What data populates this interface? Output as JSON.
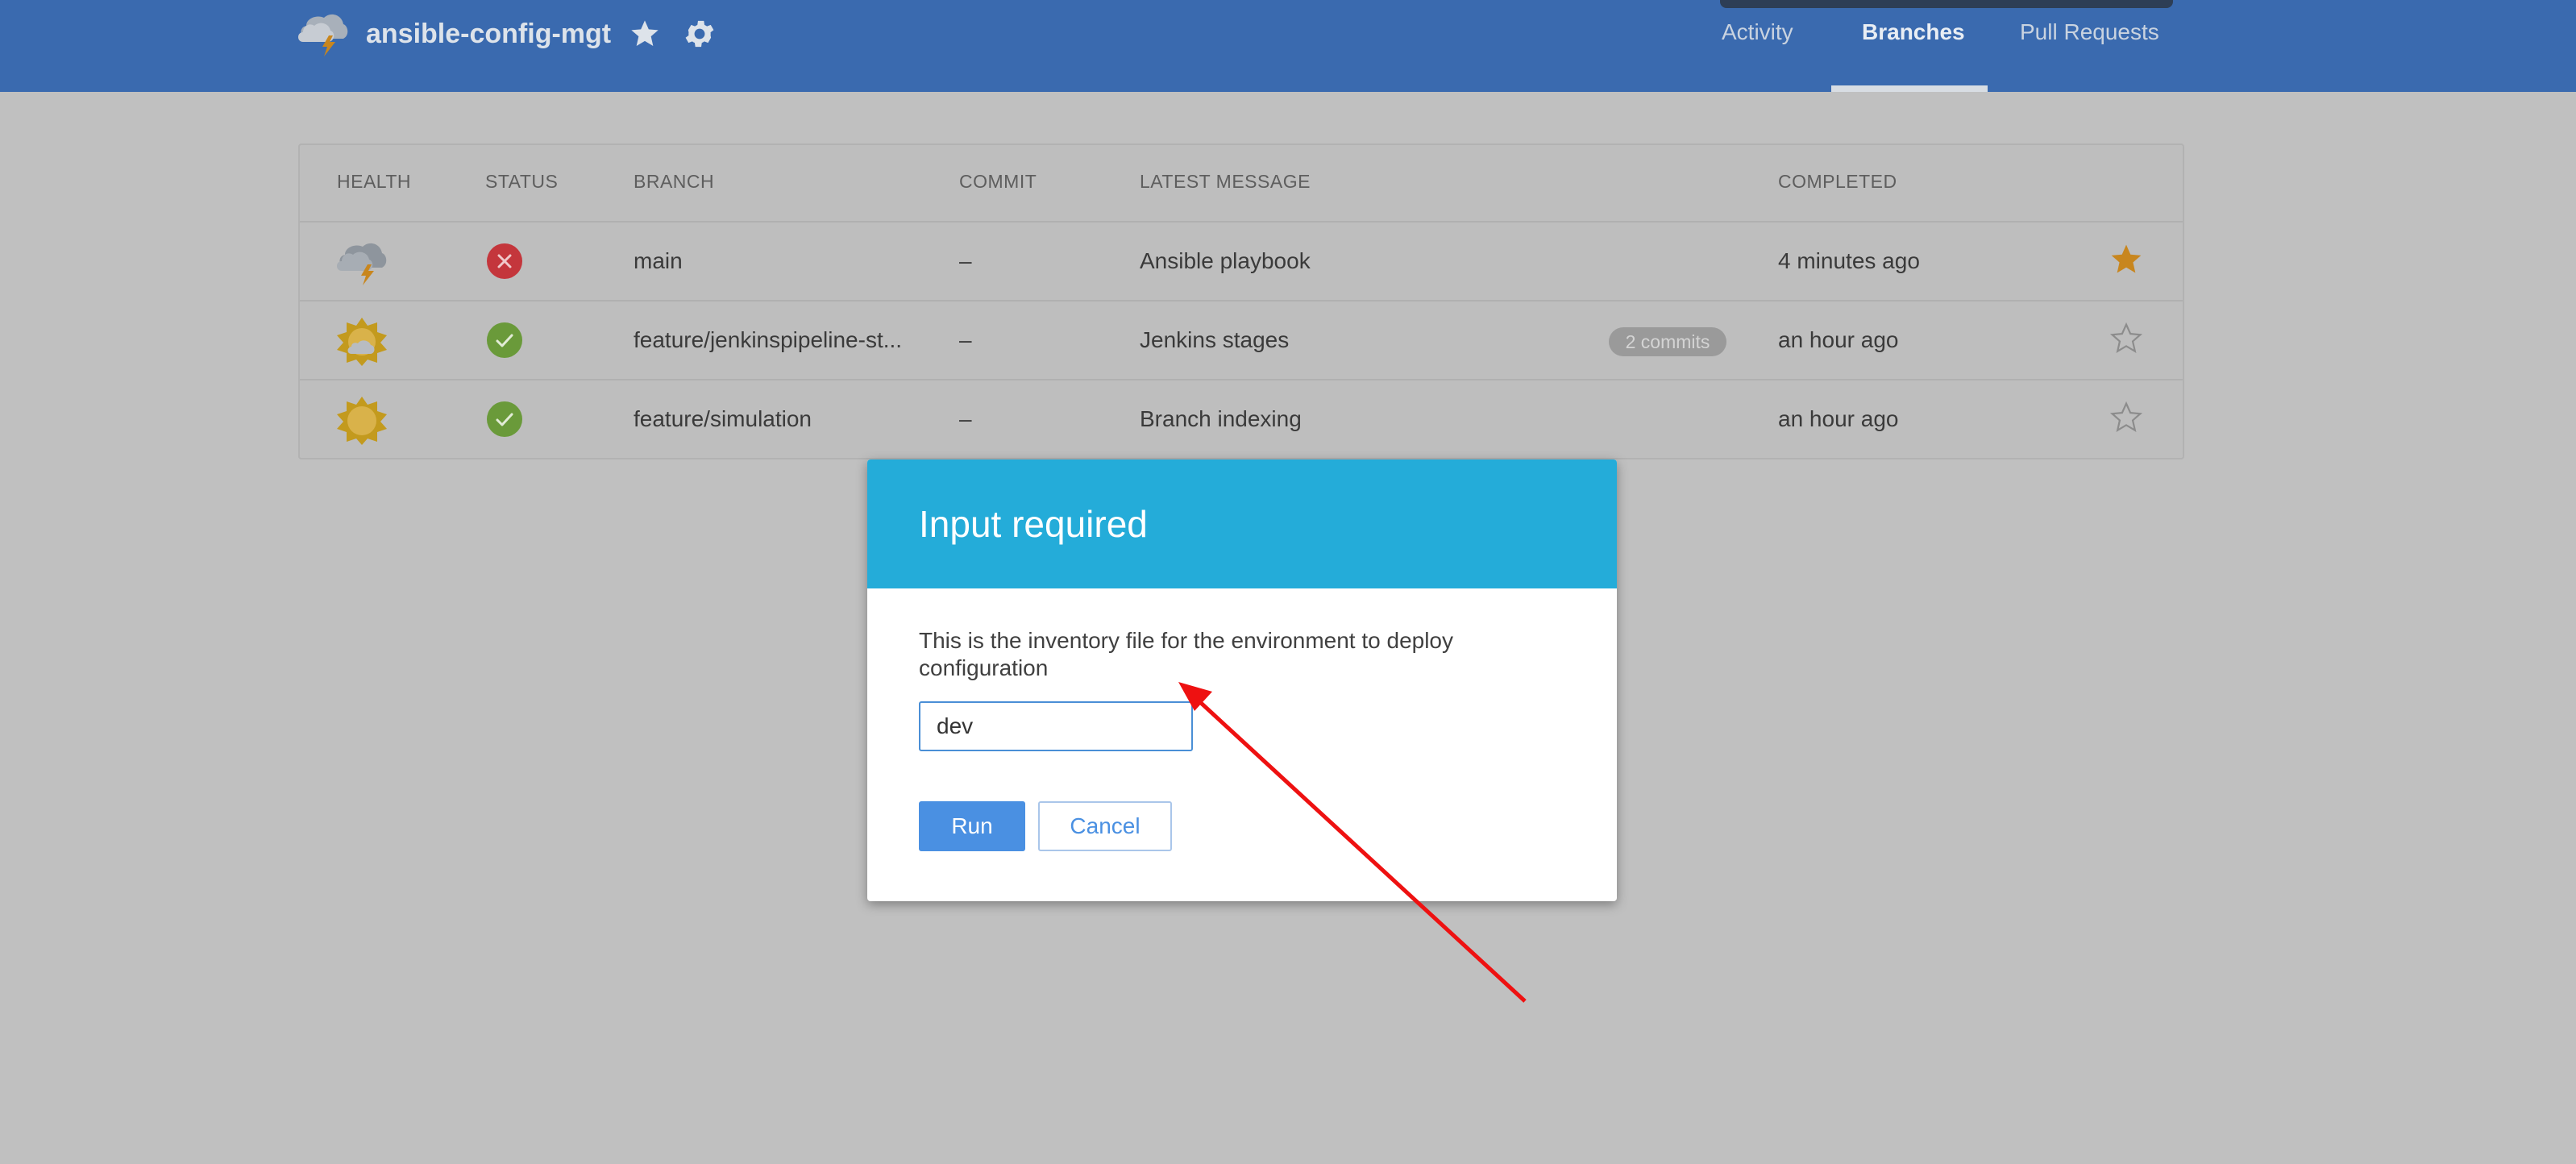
{
  "header": {
    "repo_name": "ansible-config-mgt",
    "nav": [
      {
        "label": "Activity"
      },
      {
        "label": "Branches"
      },
      {
        "label": "Pull Requests"
      }
    ]
  },
  "table": {
    "columns": [
      "HEALTH",
      "STATUS",
      "BRANCH",
      "COMMIT",
      "LATEST MESSAGE",
      "COMPLETED"
    ],
    "rows": [
      {
        "health": "stormy-icon",
        "status": "failed",
        "branch": "main",
        "commit": "–",
        "message": "Ansible playbook",
        "badge": "",
        "completed": "4 minutes ago",
        "favorite": true
      },
      {
        "health": "partly-sunny-icon",
        "status": "success",
        "branch": "feature/jenkinspipeline-st...",
        "commit": "–",
        "message": "Jenkins stages",
        "badge": "2 commits",
        "completed": "an hour ago",
        "favorite": false
      },
      {
        "health": "sunny-icon",
        "status": "success",
        "branch": "feature/simulation",
        "commit": "–",
        "message": "Branch indexing",
        "badge": "",
        "completed": "an hour ago",
        "favorite": false
      }
    ]
  },
  "modal": {
    "title": "Input required",
    "description": "This is the inventory file for the environment to deploy configuration",
    "input_value": "dev",
    "run_label": "Run",
    "cancel_label": "Cancel"
  },
  "colors": {
    "header_bg": "#3a6aaf",
    "modal_header_bg": "#24acd9",
    "primary_button": "#4a90e2",
    "failed": "#c4363c",
    "success": "#6a9a3a",
    "favorite_star": "#c8861e",
    "annotation_arrow": "#ee1111"
  }
}
